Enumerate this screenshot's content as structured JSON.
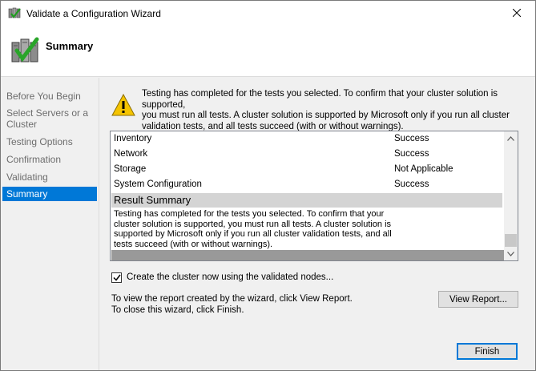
{
  "window": {
    "title": "Validate a Configuration Wizard",
    "icon": "cluster-wizard-icon",
    "close_icon": "close-icon"
  },
  "header": {
    "title": "Summary",
    "icon": "cluster-validated-icon"
  },
  "sidebar": {
    "items": [
      {
        "label": "Before You Begin",
        "active": false
      },
      {
        "label": "Select Servers or a",
        "label2": "Cluster",
        "active": false
      },
      {
        "label": "Testing Options",
        "active": false
      },
      {
        "label": "Confirmation",
        "active": false
      },
      {
        "label": "Validating",
        "active": false
      },
      {
        "label": "Summary",
        "active": true
      }
    ]
  },
  "main": {
    "info_lines": [
      "Testing has completed for the tests you selected. To confirm that your cluster solution is supported,",
      "you must run all tests.  A cluster solution is supported by Microsoft only if you run all cluster",
      "validation tests, and all tests succeed (with or without warnings)."
    ],
    "warning_icon": "warning-icon",
    "results": [
      {
        "name": "Inventory",
        "status": "Success"
      },
      {
        "name": "Network",
        "status": "Success"
      },
      {
        "name": "Storage",
        "status": "Not Applicable"
      },
      {
        "name": "System Configuration",
        "status": "Success"
      }
    ],
    "summary_heading": "Result Summary",
    "summary_lines": [
      "Testing has completed for the tests you selected. To confirm that your",
      "cluster solution is supported, you must run all tests.  A cluster solution is",
      "supported by Microsoft only if you run all cluster validation tests, and all",
      "tests succeed (with or without warnings)."
    ],
    "create_cluster": {
      "label": "Create the cluster now using the validated nodes...",
      "checked": true
    },
    "report_lines": [
      "To view the report created by the wizard, click View Report.",
      "To close this wizard, click Finish."
    ],
    "view_report_label": "View Report...",
    "finish_label": "Finish"
  }
}
